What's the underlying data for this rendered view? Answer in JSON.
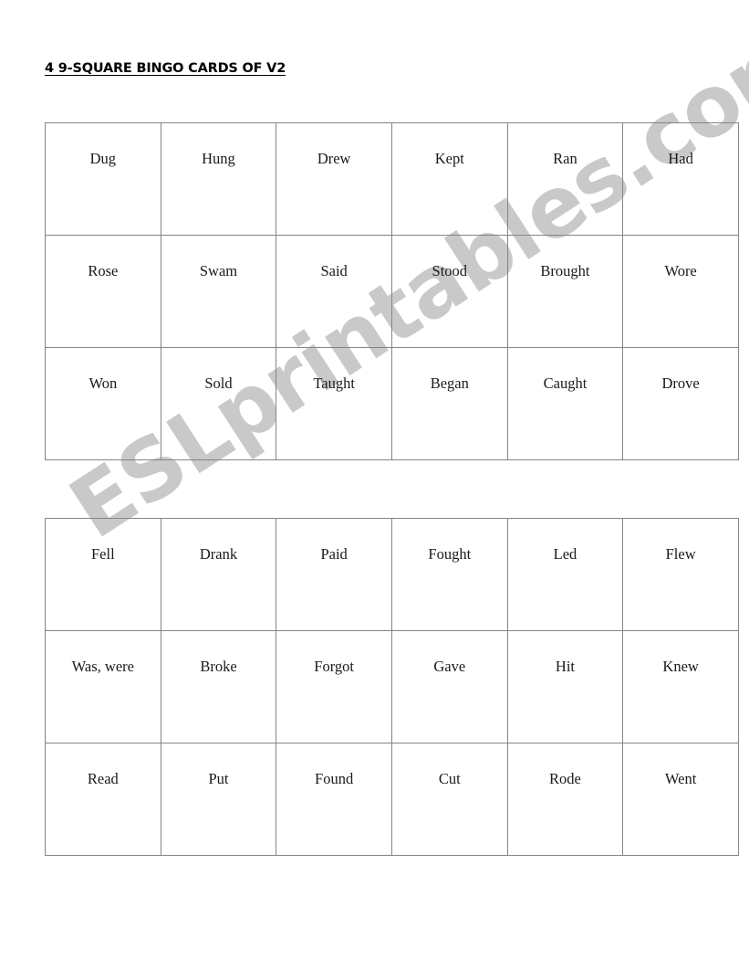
{
  "document": {
    "title": "4 9-SQUARE BINGO CARDS OF V2"
  },
  "watermark": {
    "text": "ESLprintables.com",
    "color": "#c9c9c9"
  },
  "cards": [
    {
      "id": "bingo-card-1",
      "rows": [
        [
          "Dug",
          "Hung",
          "Drew",
          "Kept",
          "Ran",
          "Had"
        ],
        [
          "Rose",
          "Swam",
          "Said",
          "Stood",
          "Brought",
          "Wore"
        ],
        [
          "Won",
          "Sold",
          "Taught",
          "Began",
          "Caught",
          "Drove"
        ]
      ]
    },
    {
      "id": "bingo-card-2",
      "rows": [
        [
          "Fell",
          "Drank",
          "Paid",
          "Fought",
          "Led",
          "Flew"
        ],
        [
          "Was, were",
          "Broke",
          "Forgot",
          "Gave",
          "Hit",
          "Knew"
        ],
        [
          "Read",
          "Put",
          "Found",
          "Cut",
          "Rode",
          "Went"
        ]
      ]
    }
  ]
}
